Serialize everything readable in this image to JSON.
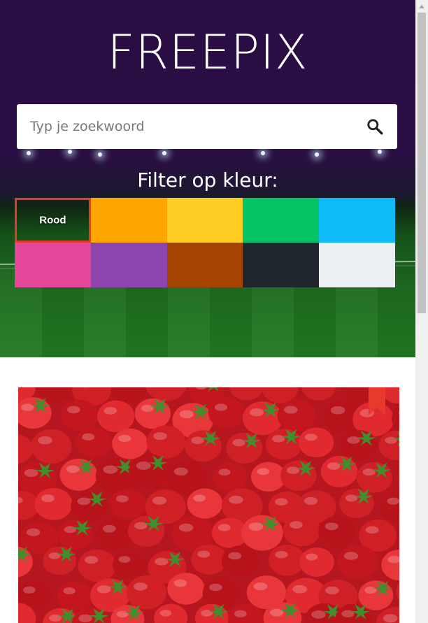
{
  "header": {
    "logo": "FREEPIX"
  },
  "search": {
    "placeholder": "Typ je zoekwoord",
    "icon": "search-icon"
  },
  "filter": {
    "title": "Filter op kleur:",
    "selected_label": "Rood",
    "swatches": [
      {
        "name": "red",
        "label": "Rood",
        "color": "#e53c30",
        "selected": true
      },
      {
        "name": "orange",
        "color": "#ffa500"
      },
      {
        "name": "yellow",
        "color": "#ffcd23"
      },
      {
        "name": "green",
        "color": "#05c466"
      },
      {
        "name": "light-blue",
        "color": "#0fbbf7"
      },
      {
        "name": "pink",
        "color": "#e4479a"
      },
      {
        "name": "purple",
        "color": "#8e44ad"
      },
      {
        "name": "brown",
        "color": "#a54400"
      },
      {
        "name": "dark",
        "color": "#20262e"
      },
      {
        "name": "white",
        "color": "#eceff1"
      }
    ]
  },
  "result": {
    "image": "strawberries-photo",
    "bookmark_icon": "bookmark-icon",
    "bookmark_color": "#e8392f"
  },
  "colors": {
    "hero_bg": "#2b0e44",
    "accent": "#e53c30"
  }
}
